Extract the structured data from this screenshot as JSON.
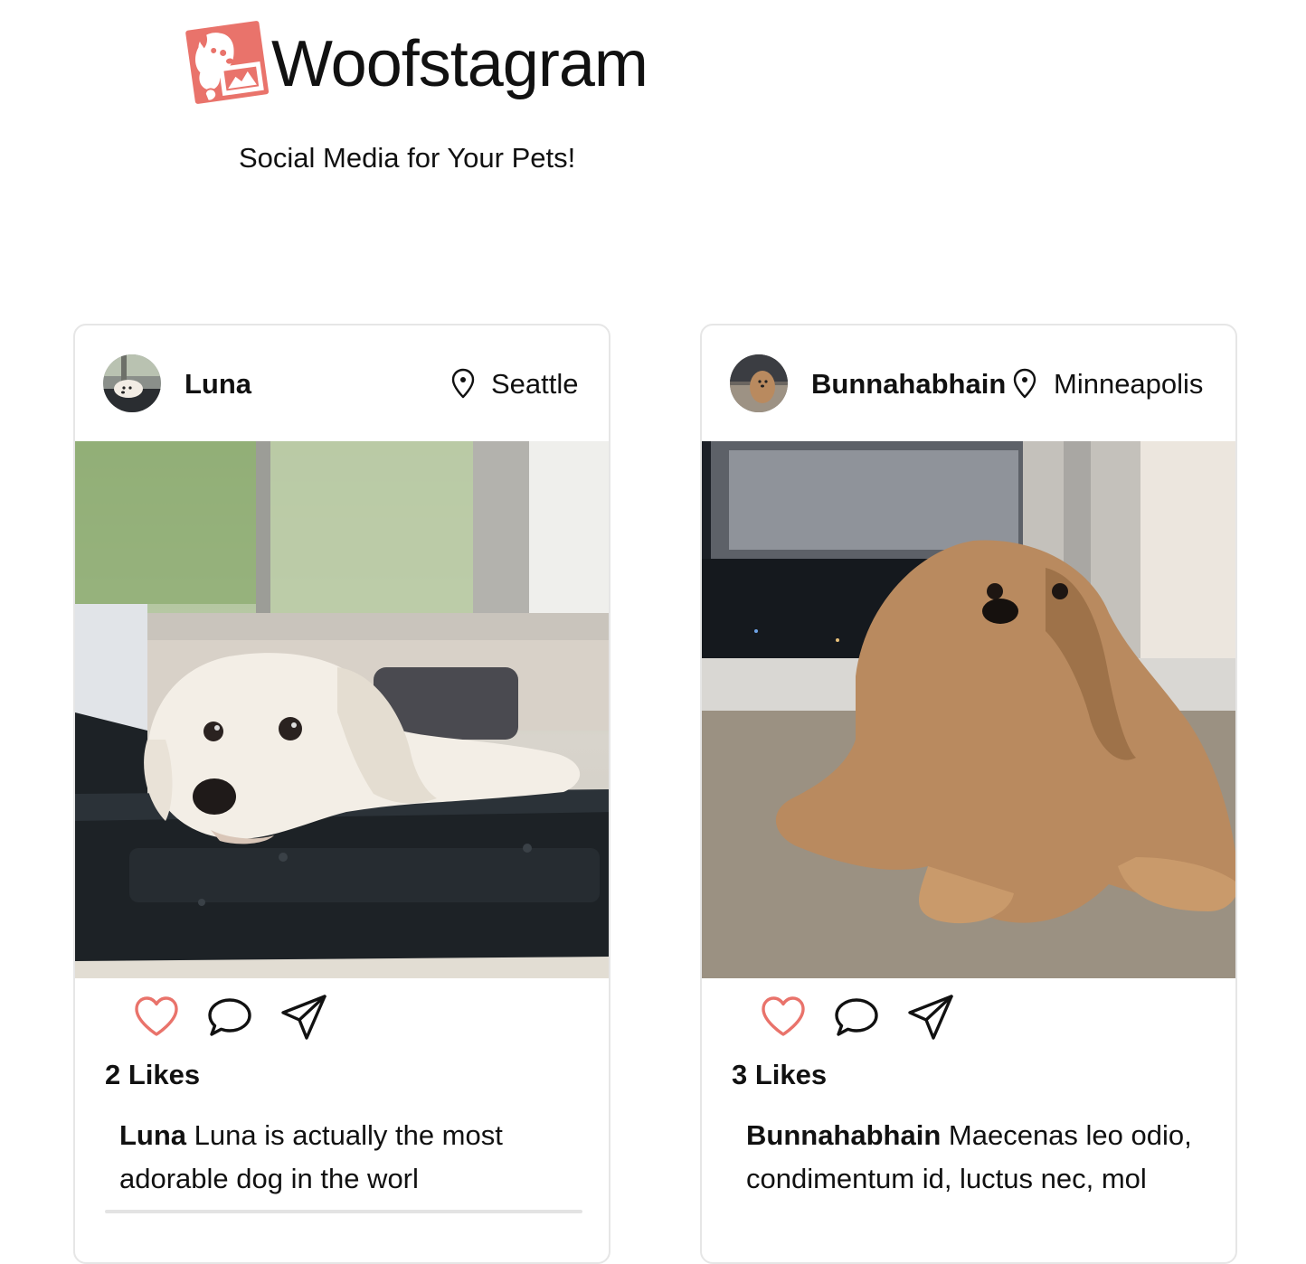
{
  "app": {
    "brand_name": "Woofstagram",
    "tagline": "Social Media for Your Pets!",
    "brand_color": "#e9736b"
  },
  "posts": [
    {
      "username": "Luna",
      "location": "Seattle",
      "likes": "2 Likes",
      "caption_user": "Luna",
      "caption_text": " Luna is actually the most adorable dog in the worl",
      "icons": [
        "heart-icon",
        "comment-icon",
        "share-icon"
      ]
    },
    {
      "username": "Bunnahabhain",
      "location": "Minneapolis",
      "likes": "3 Likes",
      "caption_user": "Bunnahabhain",
      "caption_text": " Maecenas leo odio, condimentum id, luctus nec, mol",
      "icons": [
        "heart-icon",
        "comment-icon",
        "share-icon"
      ]
    }
  ]
}
